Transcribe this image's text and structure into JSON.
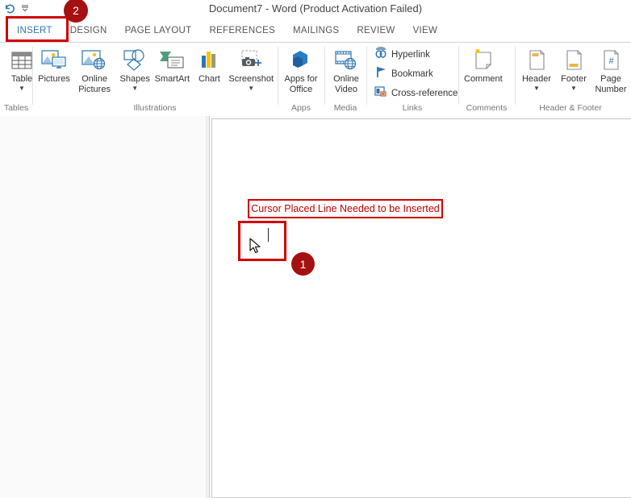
{
  "window": {
    "title": "Document7 - Word (Product Activation Failed)",
    "quick_access": [
      {
        "name": "undo-icon",
        "glyph": "↶"
      },
      {
        "name": "customize-quick-access-toolbar-icon",
        "glyph": "≡"
      }
    ]
  },
  "tabs": [
    {
      "label": "INSERT",
      "active": true
    },
    {
      "label": "DESIGN",
      "active": false
    },
    {
      "label": "PAGE LAYOUT",
      "active": false
    },
    {
      "label": "REFERENCES",
      "active": false
    },
    {
      "label": "MAILINGS",
      "active": false
    },
    {
      "label": "REVIEW",
      "active": false
    },
    {
      "label": "VIEW",
      "active": false
    }
  ],
  "ribbon": {
    "groups": [
      {
        "name": "tables",
        "label": "Tables",
        "buttons": [
          {
            "name": "table-button",
            "label": "Table",
            "icon": "table-icon",
            "caret": true
          }
        ]
      },
      {
        "name": "illustrations",
        "label": "Illustrations",
        "buttons": [
          {
            "name": "pictures-button",
            "label": "Pictures",
            "icon": "pictures-icon",
            "caret": false
          },
          {
            "name": "online-pictures-button",
            "label": "Online Pictures",
            "icon": "online-pictures-icon",
            "caret": false
          },
          {
            "name": "shapes-button",
            "label": "Shapes",
            "icon": "shapes-icon",
            "caret": true
          },
          {
            "name": "smartart-button",
            "label": "SmartArt",
            "icon": "smartart-icon",
            "caret": false
          },
          {
            "name": "chart-button",
            "label": "Chart",
            "icon": "chart-icon",
            "caret": false
          },
          {
            "name": "screenshot-button",
            "label": "Screenshot",
            "icon": "screenshot-icon",
            "caret": true
          }
        ]
      },
      {
        "name": "apps",
        "label": "Apps",
        "buttons": [
          {
            "name": "apps-for-office-button",
            "label": "Apps for Office",
            "icon": "apps-for-office-icon",
            "caret": true
          }
        ]
      },
      {
        "name": "media",
        "label": "Media",
        "buttons": [
          {
            "name": "online-video-button",
            "label": "Online Video",
            "icon": "online-video-icon",
            "caret": false
          }
        ]
      },
      {
        "name": "links",
        "label": "Links",
        "buttons": [
          {
            "name": "hyperlink-button",
            "label": "Hyperlink",
            "icon": "hyperlink-icon",
            "caret": false
          },
          {
            "name": "bookmark-button",
            "label": "Bookmark",
            "icon": "bookmark-icon",
            "caret": false
          },
          {
            "name": "cross-reference-button",
            "label": "Cross-reference",
            "icon": "cross-reference-icon",
            "caret": false
          }
        ]
      },
      {
        "name": "comments",
        "label": "Comments",
        "buttons": [
          {
            "name": "comment-button",
            "label": "Comment",
            "icon": "comment-icon",
            "caret": false
          }
        ]
      },
      {
        "name": "header-footer",
        "label": "Header & Footer",
        "buttons": [
          {
            "name": "header-button",
            "label": "Header",
            "icon": "header-icon",
            "caret": true
          },
          {
            "name": "footer-button",
            "label": "Footer",
            "icon": "footer-icon",
            "caret": true
          },
          {
            "name": "page-number-button",
            "label": "Page Number",
            "icon": "page-number-icon",
            "caret": false
          }
        ]
      }
    ]
  },
  "annotations": {
    "callout_text": "Cursor Placed Line Needed to be Inserted",
    "badge_one": "1",
    "badge_two": "2",
    "accent_color": "#c00000",
    "badge_color": "#a51010",
    "highlight_color": "#d00000"
  },
  "document": {
    "body_text": ""
  }
}
